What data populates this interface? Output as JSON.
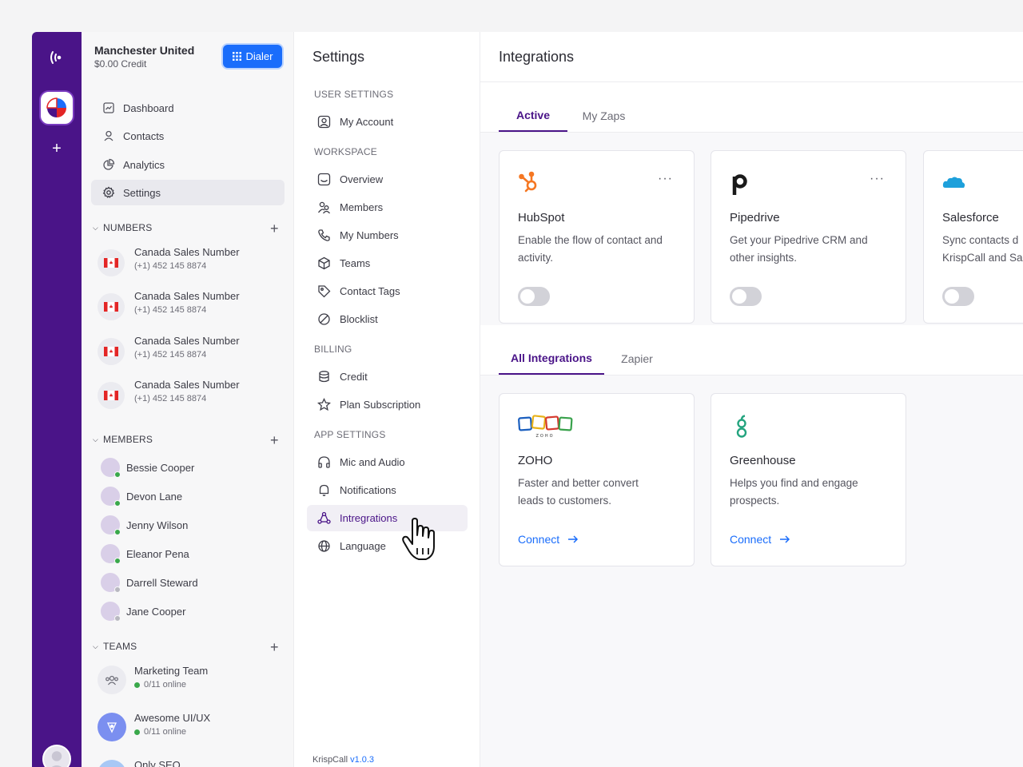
{
  "account": {
    "name": "Manchester United",
    "credit": "$0.00 Credit",
    "dialer_label": "Dialer"
  },
  "nav": [
    {
      "label": "Dashboard",
      "icon": "dashboard-icon"
    },
    {
      "label": "Contacts",
      "icon": "contacts-icon"
    },
    {
      "label": "Analytics",
      "icon": "analytics-icon"
    },
    {
      "label": "Settings",
      "icon": "gear-icon",
      "active": true
    }
  ],
  "numbers": {
    "heading": "NUMBERS",
    "items": [
      {
        "name": "Canada Sales Number",
        "phone": "(+1) 452 145 8874"
      },
      {
        "name": "Canada Sales Number",
        "phone": "(+1) 452 145 8874"
      },
      {
        "name": "Canada Sales Number",
        "phone": "(+1) 452 145 8874"
      },
      {
        "name": "Canada Sales Number",
        "phone": "(+1) 452 145 8874"
      }
    ]
  },
  "members": {
    "heading": "MEMBERS",
    "items": [
      {
        "name": "Bessie Cooper",
        "status": "online"
      },
      {
        "name": "Devon Lane",
        "status": "online"
      },
      {
        "name": "Jenny Wilson",
        "status": "online"
      },
      {
        "name": "Eleanor Pena",
        "status": "online"
      },
      {
        "name": "Darrell Steward",
        "status": "offline"
      },
      {
        "name": "Jane Cooper",
        "status": "offline"
      }
    ]
  },
  "teams": {
    "heading": "TEAMS",
    "items": [
      {
        "name": "Marketing Team",
        "online": "0/11 online"
      },
      {
        "name": "Awesome UI/UX",
        "online": "0/11 online"
      },
      {
        "name": "Only SEO",
        "online": ""
      }
    ]
  },
  "settings": {
    "title": "Settings",
    "sections": [
      {
        "heading": "USER SETTINGS",
        "items": [
          {
            "label": "My Account",
            "icon": "account-icon"
          }
        ]
      },
      {
        "heading": "WORKSPACE",
        "items": [
          {
            "label": "Overview",
            "icon": "overview-icon"
          },
          {
            "label": "Members",
            "icon": "members-icon"
          },
          {
            "label": "My Numbers",
            "icon": "phone-icon"
          },
          {
            "label": "Teams",
            "icon": "cube-icon"
          },
          {
            "label": "Contact Tags",
            "icon": "tag-icon"
          },
          {
            "label": "Blocklist",
            "icon": "block-icon"
          }
        ]
      },
      {
        "heading": "BILLING",
        "items": [
          {
            "label": "Credit",
            "icon": "database-icon"
          },
          {
            "label": "Plan Subscription",
            "icon": "star-icon"
          }
        ]
      },
      {
        "heading": "APP SETTINGS",
        "items": [
          {
            "label": "Mic and Audio",
            "icon": "headphones-icon"
          },
          {
            "label": "Notifications",
            "icon": "bell-icon"
          },
          {
            "label": "Intregrations",
            "icon": "integrations-icon",
            "active": true
          },
          {
            "label": "Language",
            "icon": "globe-icon"
          }
        ]
      }
    ],
    "version_prefix": "KrispCall",
    "version": "v1.0.3"
  },
  "integrations": {
    "title": "Integrations",
    "active_tabs": [
      "Active",
      "My Zaps"
    ],
    "all_tabs": [
      "All Integrations",
      "Zapier"
    ],
    "more_label": "···",
    "active_cards": [
      {
        "name": "HubSpot",
        "desc": "Enable the flow of contact and\nactivity.",
        "icon": "hubspot-logo",
        "enabled": false
      },
      {
        "name": "Pipedrive",
        "desc": "Get your Pipedrive CRM and\nother insights.",
        "icon": "pipedrive-logo",
        "enabled": false
      },
      {
        "name": "Salesforce",
        "desc": "Sync contacts d\nKrispCall and Sa",
        "icon": "salesforce-logo",
        "enabled": false
      }
    ],
    "all_cards": [
      {
        "name": "ZOHO",
        "desc": "Faster and better convert\nleads to customers.",
        "icon": "zoho-logo",
        "action": "Connect"
      },
      {
        "name": "Greenhouse",
        "desc": "Helps you find and engage\nprospects.",
        "icon": "greenhouse-logo",
        "action": "Connect"
      }
    ]
  },
  "colors": {
    "brand": "#4a1488",
    "accent": "#1a6dfb",
    "online": "#3aa84b"
  }
}
